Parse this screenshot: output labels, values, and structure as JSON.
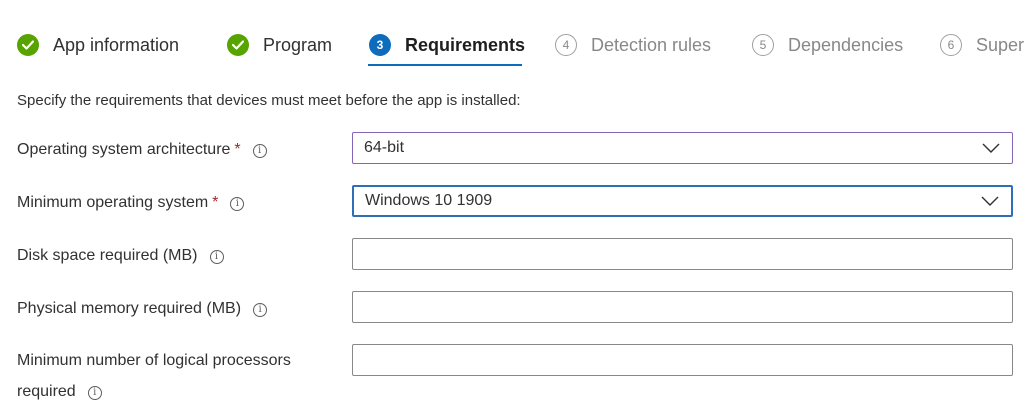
{
  "wizard": {
    "steps": [
      {
        "number": "",
        "label": "App information",
        "state": "done"
      },
      {
        "number": "",
        "label": "Program",
        "state": "done"
      },
      {
        "number": "3",
        "label": "Requirements",
        "state": "current"
      },
      {
        "number": "4",
        "label": "Detection rules",
        "state": "pending"
      },
      {
        "number": "5",
        "label": "Dependencies",
        "state": "pending"
      },
      {
        "number": "6",
        "label": "Super",
        "state": "pending"
      }
    ]
  },
  "form": {
    "description": "Specify the requirements that devices must meet before the app is installed:",
    "required_marker": "*",
    "info_glyph": "i",
    "os_architecture": {
      "label": "Operating system architecture",
      "value": "64-bit"
    },
    "min_os": {
      "label": "Minimum operating system",
      "value": "Windows 10 1909"
    },
    "disk_space": {
      "label": "Disk space required (MB)",
      "value": ""
    },
    "physical_memory": {
      "label": "Physical memory required (MB)",
      "value": ""
    },
    "logical_processors": {
      "label_line1": "Minimum number of logical processors",
      "label_line2": "required",
      "value": ""
    }
  },
  "colors": {
    "done": "#57a300",
    "current": "#0f6cbd",
    "required": "#a4262c",
    "focus_border": "#2f6fb8"
  },
  "icons": {
    "done": "checkmark-icon",
    "dropdown": "chevron-down-icon",
    "info": "info-icon"
  }
}
